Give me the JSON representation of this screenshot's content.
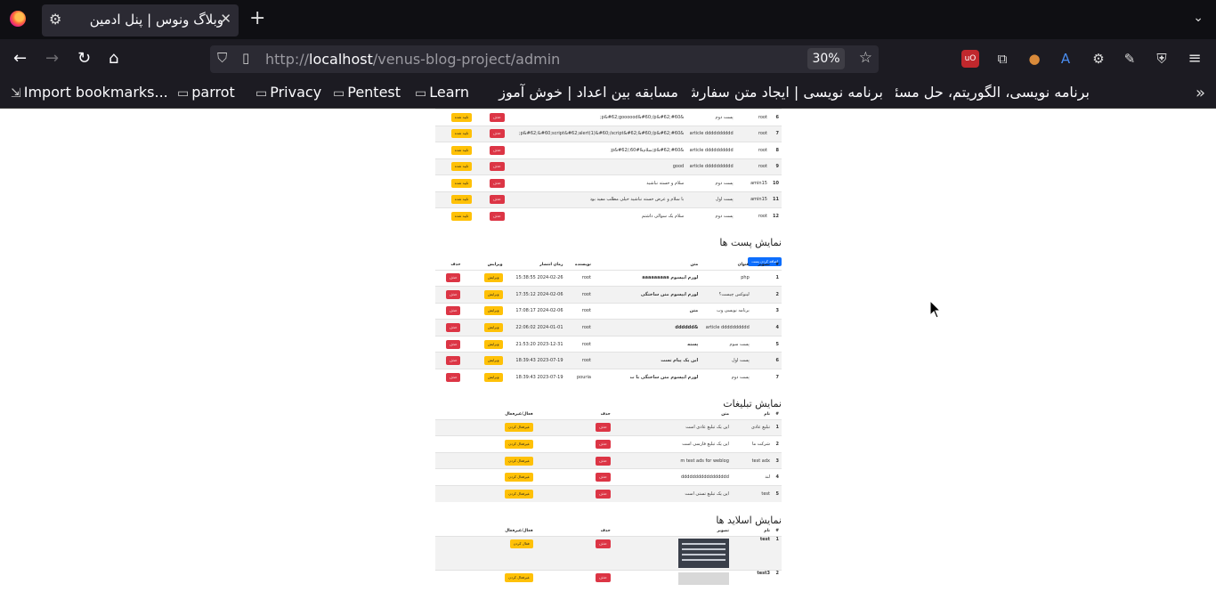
{
  "browser": {
    "tab_title": "وبلاگ ونوس | پنل ادمین",
    "url_prefix": "http://",
    "url_host": "localhost",
    "url_path": "/venus-blog-project/admin",
    "zoom": "30%",
    "bookmarks": [
      "Import bookmarks...",
      "parrot",
      "Privacy",
      "Pentest",
      "Learn",
      "مسابقه بین اعداد | خوش آموز",
      "برنامه نویسی | ایجاد متن سفارشی",
      "برنامه نویسی، الگوریتم، حل مسئله"
    ]
  },
  "comments": {
    "rows": [
      {
        "id": "6",
        "user": "root",
        "post": "پست دوم",
        "text": "&#60;p&#62;goooood&#60;/p&#62;",
        "del": "حذف",
        "status": "تایید شده"
      },
      {
        "id": "7",
        "user": "root",
        "post": "article dddddddddd",
        "text": "&#60;p&#62;&#60;script&#62;alert(1)&#60;/script&#62;&#60;/p&#62;",
        "del": "حذف",
        "status": "تایید شده"
      },
      {
        "id": "8",
        "user": "root",
        "post": "article dddddddddd",
        "text": "&#60;p&#62;سلام&#60;/p&#62;",
        "del": "حذف",
        "status": "تایید شده"
      },
      {
        "id": "9",
        "user": "root",
        "post": "article dddddddddd",
        "text": "good",
        "del": "حذف",
        "status": "تایید شده"
      },
      {
        "id": "10",
        "user": "amin15",
        "post": "پست دوم",
        "text": "سلام و خسته نباشید",
        "del": "حذف",
        "status": "تایید شده"
      },
      {
        "id": "11",
        "user": "amin15",
        "post": "پست اول",
        "text": "با سلام و عرض خسته نباشید خیلی مطلب مفید بود",
        "del": "حذف",
        "status": "تایید شده"
      },
      {
        "id": "12",
        "user": "root",
        "post": "پست دوم",
        "text": "سلام یک سوالی داشتم",
        "del": "حذف",
        "status": "تایید شده"
      }
    ]
  },
  "posts": {
    "title": "نمایش پست ها",
    "add_button": "اضافه کردن پست",
    "headers": [
      "#",
      "تصویر",
      "عنوان",
      "متن",
      "نویسنده",
      "زمان انتشار",
      "ویرایش",
      "حذف"
    ],
    "rows": [
      {
        "id": "1",
        "title": "php",
        "text": "لورم ایپسوم aaaaaaaaa",
        "author": "root",
        "date": "2024-02-26 15:38:55",
        "edit": "ویرایش",
        "del": "حذف"
      },
      {
        "id": "2",
        "title": "لینوکس چیست؟",
        "text": "لورم ایپسوم متن ساختگی",
        "author": "root",
        "date": "2024-02-06 17:35:12",
        "edit": "ویرایش",
        "del": "حذف"
      },
      {
        "id": "3",
        "title": "برنامه نویسی وب",
        "text": "متن",
        "author": "root",
        "date": "2024-02-06 17:08:17",
        "edit": "ویرایش",
        "del": "حذف"
      },
      {
        "id": "4",
        "title": "article dddddddddd",
        "text": "&dddddd",
        "author": "root",
        "date": "2024-01-01 22:06:02",
        "edit": "ویرایش",
        "del": "حذف"
      },
      {
        "id": "5",
        "title": "پست سوم",
        "text": "پسته",
        "author": "root",
        "date": "2023-12-31 21:53:20",
        "edit": "ویرایش",
        "del": "حذف"
      },
      {
        "id": "6",
        "title": "پست اول",
        "text": "این یک پیام تست",
        "author": "root",
        "date": "2023-07-19 18:39:43",
        "edit": "ویرایش",
        "del": "حذف"
      },
      {
        "id": "7",
        "title": "پست دوم",
        "text": "لورم ایپسوم متن ساختگی با ت",
        "author": "pouria",
        "date": "2023-07-19 18:39:43",
        "edit": "ویرایش",
        "del": "حذف"
      }
    ]
  },
  "ads": {
    "title": "نمایش تبلیغات",
    "headers": [
      "#",
      "نام",
      "متن",
      "حذف",
      "فعال/غیرفعال"
    ],
    "rows": [
      {
        "id": "1",
        "name": "تبلیغ عادی",
        "text": "این یک تبلیغ عادی است",
        "del": "حذف",
        "toggle": "غیرفعال کردن"
      },
      {
        "id": "2",
        "name": "شرکت ما",
        "text": "این یک تبلیغ فارسی است",
        "del": "حذف",
        "toggle": "غیرفعال کردن"
      },
      {
        "id": "3",
        "name": "test adx",
        "text": "m test ads for weblog",
        "del": "حذف",
        "toggle": "غیرفعال کردن"
      },
      {
        "id": "4",
        "name": "لند",
        "text": "ddddddddddddddddd",
        "del": "حذف",
        "toggle": "غیرفعال کردن"
      },
      {
        "id": "5",
        "name": "test",
        "text": "این یک تبلیغ تستی است",
        "del": "حذف",
        "toggle": "غیرفعال کردن"
      }
    ]
  },
  "slides": {
    "title": "نمایش اسلاید ها",
    "headers": [
      "#",
      "نام",
      "تصویر",
      "حذف",
      "فعال/غیرفعال"
    ],
    "rows": [
      {
        "id": "1",
        "name": "test",
        "del": "حذف",
        "toggle": "فعال کردن"
      },
      {
        "id": "2",
        "name": "test3",
        "del": "حذف",
        "toggle": "غیرفعال کردن"
      }
    ]
  },
  "colors": {
    "danger": "#dc3545",
    "warning": "#ffc107",
    "primary": "#0d6efd"
  }
}
